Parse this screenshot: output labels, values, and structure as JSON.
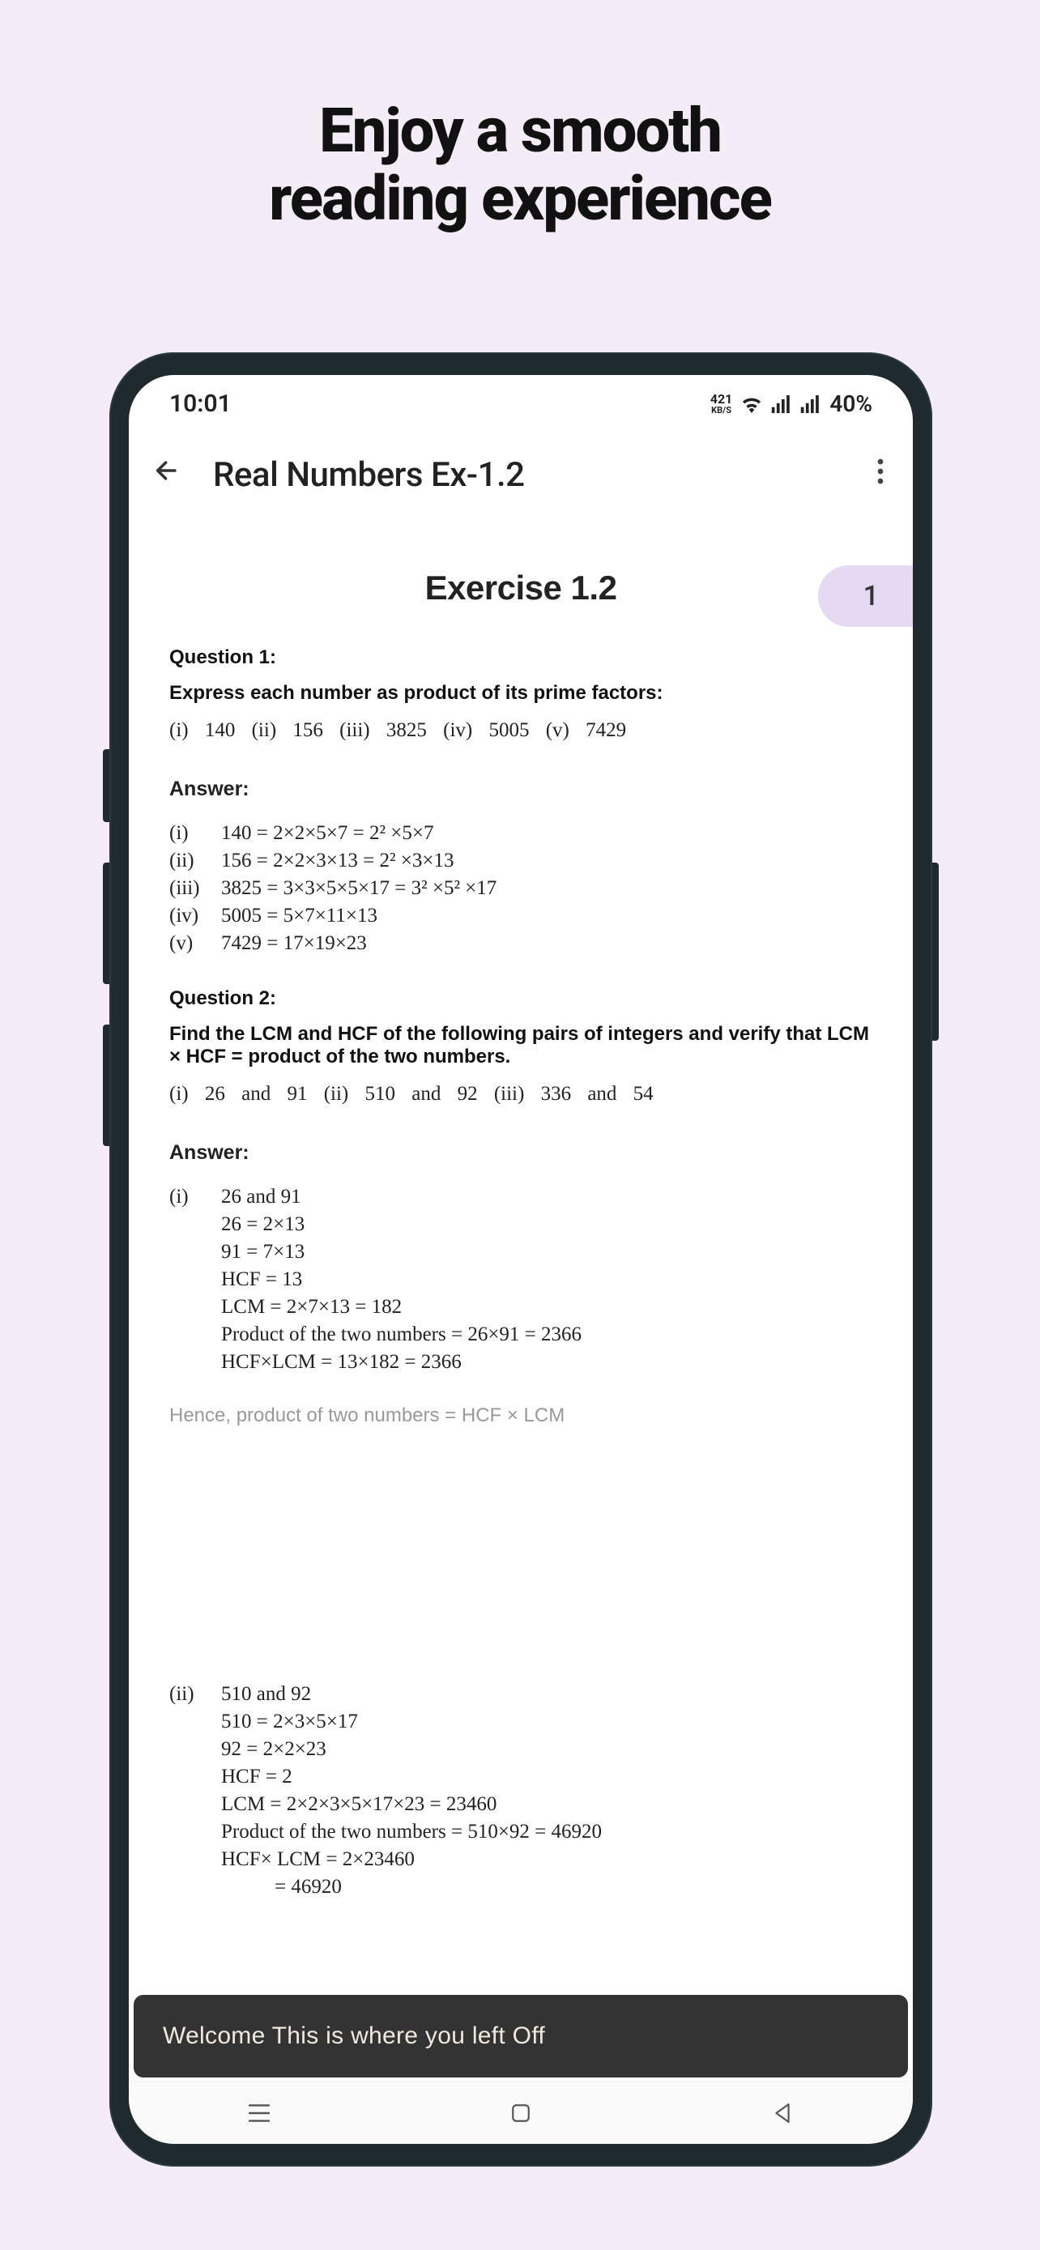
{
  "promo": {
    "line1": "Enjoy a smooth",
    "line2": "reading experience"
  },
  "status": {
    "time": "10:01",
    "kbs_top": "421",
    "kbs_bottom": "KB/S",
    "battery": "40%"
  },
  "appbar": {
    "title": "Real Numbers Ex-1.2"
  },
  "page_badge": "1",
  "content": {
    "exercise_title": "Exercise 1.2",
    "q1_label": "Question 1:",
    "q1_text": "Express each number as product of its prime factors:",
    "q1_items": "(i)   140   (ii)   156   (iii)   3825   (iv)   5005   (v)   7429",
    "answer_label": "Answer:",
    "a1_i_roman": "(i)",
    "a1_i": "140 = 2×2×5×7 = 2² ×5×7",
    "a1_ii_roman": "(ii)",
    "a1_ii": "156 = 2×2×3×13 = 2² ×3×13",
    "a1_iii_roman": "(iii)",
    "a1_iii": "3825 = 3×3×5×5×17 = 3² ×5² ×17",
    "a1_iv_roman": "(iv)",
    "a1_iv": "5005 = 5×7×11×13",
    "a1_v_roman": "(v)",
    "a1_v": "7429 = 17×19×23",
    "q2_label": "Question 2:",
    "q2_text": "Find the LCM and HCF of the following pairs of integers and verify that LCM × HCF = product of the two numbers.",
    "q2_items": "(i)   26 and 91    (ii)   510 and 92   (iii)   336 and 54",
    "a2_i_roman": "(i)",
    "a2_i_head": "26 and 91",
    "a2_i_l1": "26 = 2×13",
    "a2_i_l2": "91 = 7×13",
    "a2_i_l3": "HCF = 13",
    "a2_i_l4": "LCM = 2×7×13 = 182",
    "a2_i_l5": "Product of the two numbers = 26×91 = 2366",
    "a2_i_l6": "HCF×LCM = 13×182 = 2366",
    "hence": "Hence, product of two numbers = HCF × LCM",
    "a2_ii_roman": "(ii)",
    "a2_ii_head": "510 and 92",
    "a2_ii_l1": "510 = 2×3×5×17",
    "a2_ii_l2": "92 = 2×2×23",
    "a2_ii_l3": "HCF = 2",
    "a2_ii_l4": "LCM = 2×2×3×5×17×23 = 23460",
    "a2_ii_l5": "Product of the two numbers = 510×92 = 46920",
    "a2_ii_l6": "HCF× LCM = 2×23460",
    "a2_ii_l7": "          = 46920"
  },
  "toast": "Welcome This is where you left Off"
}
